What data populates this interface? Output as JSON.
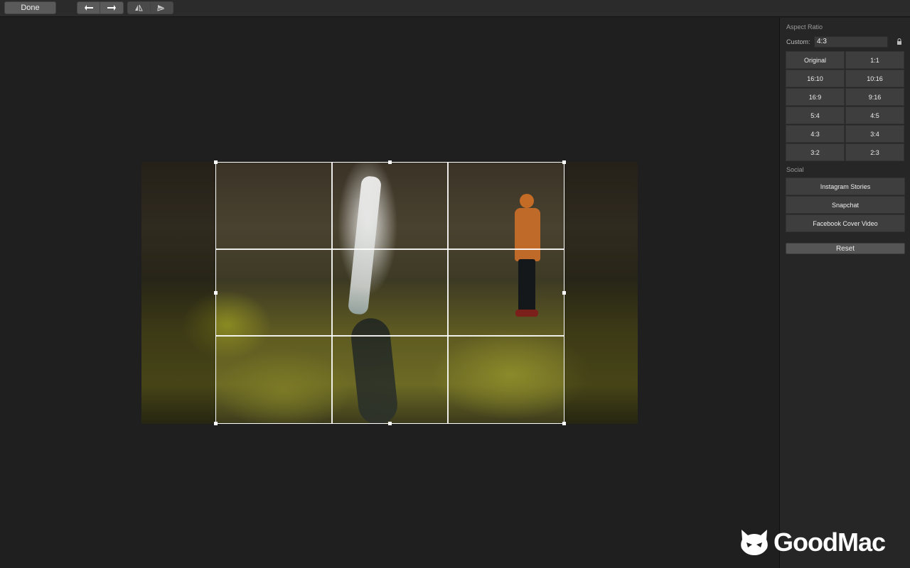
{
  "toolbar": {
    "done_label": "Done",
    "undo_icon": "undo-arrow-icon",
    "redo_icon": "redo-arrow-icon",
    "flip_horizontal_icon": "flip-horizontal-icon",
    "flip_vertical_icon": "flip-vertical-icon"
  },
  "sidebar": {
    "aspect_ratio_title": "Aspect Ratio",
    "custom_label": "Custom:",
    "custom_value": "4:3",
    "lock_icon": "lock-icon",
    "presets": [
      "Original",
      "1:1",
      "16:10",
      "10:16",
      "16:9",
      "9:16",
      "5:4",
      "4:5",
      "4:3",
      "3:4",
      "3:2",
      "2:3"
    ],
    "social_title": "Social",
    "social": [
      "Instagram Stories",
      "Snapchat",
      "Facebook Cover Video"
    ],
    "reset_label": "Reset"
  },
  "watermark": {
    "text": "GoodMac"
  },
  "colors": {
    "background": "#1f1f1f",
    "toolbar": "#2b2b2b",
    "sidebar": "#262626",
    "button": "#3e3e3e",
    "crop_line": "#ffffff"
  }
}
